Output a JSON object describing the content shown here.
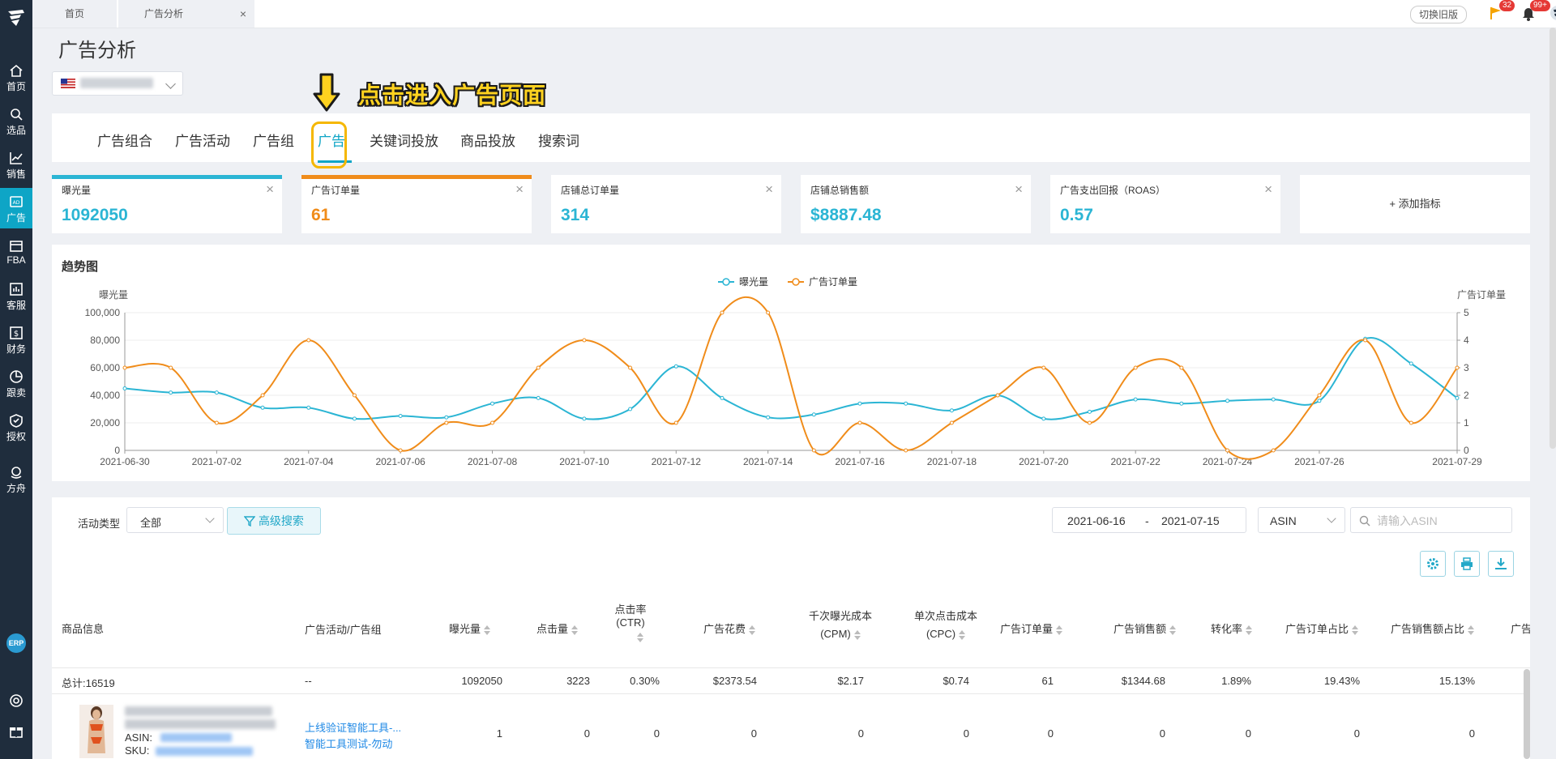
{
  "top_tabs": {
    "home": "首页",
    "current": "广告分析",
    "close": "×"
  },
  "topbar": {
    "old_version": "切换旧版",
    "flag_badge": "32",
    "bell_badge": "99+"
  },
  "sidebar": {
    "items": [
      {
        "label": "首页",
        "icon": "home-icon"
      },
      {
        "label": "选品",
        "icon": "search-icon"
      },
      {
        "label": "销售",
        "icon": "chart-line-icon"
      },
      {
        "label": "广告",
        "icon": "ad-icon"
      },
      {
        "label": "FBA",
        "icon": "box-icon"
      },
      {
        "label": "客服",
        "icon": "report-icon"
      },
      {
        "label": "财务",
        "icon": "dollar-icon"
      },
      {
        "label": "跟卖",
        "icon": "pie-icon"
      },
      {
        "label": "授权",
        "icon": "shield-icon"
      },
      {
        "label": "方舟",
        "icon": "ark-icon"
      }
    ],
    "erp": "ERP"
  },
  "page": {
    "title": "广告分析"
  },
  "annotation": {
    "text": "点击进入广告页面"
  },
  "nav_tabs": [
    "广告组合",
    "广告活动",
    "广告组",
    "广告",
    "关键词投放",
    "商品投放",
    "搜索词"
  ],
  "metric_cards": [
    {
      "label": "曝光量",
      "value": "1092050",
      "color": "#2bb5d4"
    },
    {
      "label": "广告订单量",
      "value": "61",
      "color": "#f08c1a"
    },
    {
      "label": "店铺总订单量",
      "value": "314",
      "color": "#2bb5d4"
    },
    {
      "label": "店铺总销售额",
      "value": "$8887.48",
      "color": "#2bb5d4"
    },
    {
      "label": "广告支出回报（ROAS）",
      "value": "0.57",
      "color": "#2bb5d4"
    }
  ],
  "add_metric": "+ 添加指标",
  "chart": {
    "title": "趋势图",
    "legend": [
      "曝光量",
      "广告订单量"
    ],
    "left_axis_label": "曝光量",
    "right_axis_label": "广告订单量",
    "left_ticks": [
      "0",
      "20,000",
      "40,000",
      "60,000",
      "80,000",
      "100,000"
    ],
    "right_ticks": [
      "0",
      "1",
      "2",
      "3",
      "4",
      "5"
    ],
    "x_ticks": [
      "2021-06-30",
      "2021-07-02",
      "2021-07-04",
      "2021-07-06",
      "2021-07-08",
      "2021-07-10",
      "2021-07-12",
      "2021-07-14",
      "2021-07-16",
      "2021-07-18",
      "2021-07-20",
      "2021-07-22",
      "2021-07-24",
      "2021-07-26",
      "2021-07-29"
    ]
  },
  "chart_data": {
    "type": "line",
    "x": [
      "2021-06-30",
      "2021-07-01",
      "2021-07-02",
      "2021-07-03",
      "2021-07-04",
      "2021-07-05",
      "2021-07-06",
      "2021-07-07",
      "2021-07-08",
      "2021-07-09",
      "2021-07-10",
      "2021-07-11",
      "2021-07-12",
      "2021-07-13",
      "2021-07-14",
      "2021-07-15",
      "2021-07-16",
      "2021-07-17",
      "2021-07-18",
      "2021-07-19",
      "2021-07-20",
      "2021-07-21",
      "2021-07-22",
      "2021-07-23",
      "2021-07-24",
      "2021-07-25",
      "2021-07-26",
      "2021-07-27",
      "2021-07-28",
      "2021-07-29"
    ],
    "series": [
      {
        "name": "曝光量",
        "axis": "left",
        "color": "#2bb5d4",
        "values": [
          45000,
          42000,
          42000,
          31000,
          31000,
          23000,
          25000,
          24000,
          34000,
          38000,
          23000,
          30000,
          61000,
          38000,
          24000,
          26000,
          34000,
          34000,
          29000,
          40000,
          23000,
          28000,
          37000,
          34000,
          36000,
          37000,
          36000,
          81000,
          63000,
          38000
        ]
      },
      {
        "name": "广告订单量",
        "axis": "right",
        "color": "#f08c1a",
        "values": [
          3,
          3,
          1,
          2,
          4,
          2,
          0,
          1,
          1,
          3,
          4,
          3,
          1,
          5,
          5,
          0,
          1,
          0,
          1,
          2,
          3,
          1,
          3,
          3,
          0,
          0,
          2,
          4,
          1,
          3
        ]
      }
    ],
    "left_ylim": [
      0,
      100000
    ],
    "right_ylim": [
      0,
      5
    ],
    "legend": "top-center",
    "grid": true
  },
  "filters": {
    "activity_type_label": "活动类型",
    "activity_type_value": "全部",
    "advanced_search": "高级搜索",
    "date_start": "2021-06-16",
    "date_sep": "-",
    "date_end": "2021-07-15",
    "id_type": "ASIN",
    "search_placeholder": "请输入ASIN"
  },
  "table": {
    "columns": [
      "商品信息",
      "广告活动/广告组",
      "曝光量",
      "点击量",
      "点击率",
      "(CTR)",
      "广告花费",
      "千次曝光成本",
      "(CPM)",
      "单次点击成本",
      "(CPC)",
      "广告订单量",
      "广告销售额",
      "转化率",
      "广告订单占比",
      "广告销售额占比",
      "广告"
    ],
    "total_row": {
      "label": "总计:16519",
      "campaign": "--",
      "impressions": "1092050",
      "clicks": "3223",
      "ctr": "0.30%",
      "spend": "$2373.54",
      "cpm": "$2.17",
      "cpc": "$0.74",
      "orders": "61",
      "sales": "$1344.68",
      "cvr": "1.89%",
      "order_share": "19.43%",
      "sales_share": "15.13%"
    },
    "rows": [
      {
        "asin_label": "ASIN:",
        "sku_label": "SKU:",
        "campaign": "上线验证智能工具-...",
        "ad_group": "智能工具测试-勿动",
        "impressions": "1",
        "clicks": "0",
        "ctr": "0",
        "spend": "0",
        "cpm": "0",
        "cpc": "0",
        "orders": "0",
        "sales": "0",
        "cvr": "0",
        "order_share": "0",
        "sales_share": "0"
      }
    ]
  }
}
